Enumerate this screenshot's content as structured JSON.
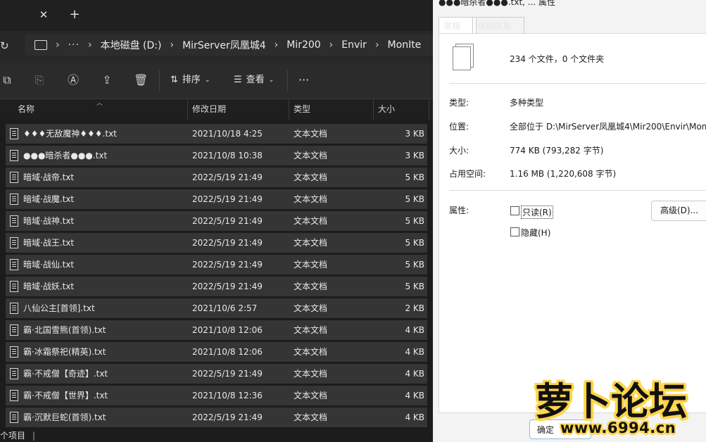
{
  "explorer": {
    "tab_close": "✕",
    "tab_new": "+",
    "breadcrumbs": [
      "本地磁盘 (D:)",
      "MirServer凤凰城4",
      "Mir200",
      "Envir",
      "MonIte"
    ],
    "breadcrumb_more": "···",
    "toolbar": {
      "sort_label": "排序",
      "view_label": "查看",
      "more": "···"
    },
    "columns": {
      "name": "名称",
      "date": "修改日期",
      "type": "类型",
      "size": "大小"
    },
    "rows": [
      {
        "name": "♦♦♦无敌魔神♦♦♦.txt",
        "date": "2021/10/18 4:25",
        "type": "文本文档",
        "size": "3 KB"
      },
      {
        "name": "●●●暗杀者●●●.txt",
        "date": "2021/10/8 10:38",
        "type": "文本文档",
        "size": "3 KB"
      },
      {
        "name": "暗域·战帝.txt",
        "date": "2022/5/19 21:49",
        "type": "文本文档",
        "size": "5 KB"
      },
      {
        "name": "暗域·战魔.txt",
        "date": "2022/5/19 21:49",
        "type": "文本文档",
        "size": "5 KB"
      },
      {
        "name": "暗域·战神.txt",
        "date": "2022/5/19 21:49",
        "type": "文本文档",
        "size": "5 KB"
      },
      {
        "name": "暗域·战王.txt",
        "date": "2022/5/19 21:49",
        "type": "文本文档",
        "size": "5 KB"
      },
      {
        "name": "暗域·战仙.txt",
        "date": "2022/5/19 21:49",
        "type": "文本文档",
        "size": "5 KB"
      },
      {
        "name": "暗域·战妖.txt",
        "date": "2022/5/19 21:49",
        "type": "文本文档",
        "size": "5 KB"
      },
      {
        "name": "八仙公主[首领].txt",
        "date": "2021/10/6 2:57",
        "type": "文本文档",
        "size": "2 KB"
      },
      {
        "name": "霸·北国雪熊(首领).txt",
        "date": "2021/10/8 12:06",
        "type": "文本文档",
        "size": "4 KB"
      },
      {
        "name": "霸·冰霜祭祀(精英).txt",
        "date": "2021/10/8 12:06",
        "type": "文本文档",
        "size": "4 KB"
      },
      {
        "name": "霸·不戒僧【奇迹】.txt",
        "date": "2022/5/19 21:49",
        "type": "文本文档",
        "size": "4 KB"
      },
      {
        "name": "霸·不戒僧【世界】.txt",
        "date": "2021/10/8 12:36",
        "type": "文本文档",
        "size": "4 KB"
      },
      {
        "name": "霸·沉默巨蛇(首领).txt",
        "date": "2022/5/19 21:49",
        "type": "文本文档",
        "size": "4 KB"
      }
    ],
    "status": "个项目"
  },
  "properties": {
    "title": "●●●暗杀者●●●.txt, ... 属性",
    "tabs": {
      "general": "常规",
      "details": "详细信息"
    },
    "summary": "234 个文件，0 个文件夹",
    "type_label": "类型:",
    "type_value": "多种类型",
    "location_label": "位置:",
    "location_value": "全部位于 D:\\MirServer凤凰城4\\Mir200\\Envir\\Mon",
    "size_label": "大小:",
    "size_value": "774 KB (793,282 字节)",
    "disk_label": "占用空间:",
    "disk_value": "1.16 MB (1,220,608 字节)",
    "attr_label": "属性:",
    "readonly_label": "只读(R)",
    "hidden_label": "隐藏(H)",
    "advanced_label": "高级(D)...",
    "ok_label": "确定"
  },
  "watermark": {
    "main": "萝卜论坛",
    "url": "www.6994.cn"
  },
  "colors": {
    "row_bg": "#353535",
    "dialog_bg": "#f3f3f3",
    "watermark_fill": "#111111",
    "watermark_outline": "#ffd54a"
  }
}
